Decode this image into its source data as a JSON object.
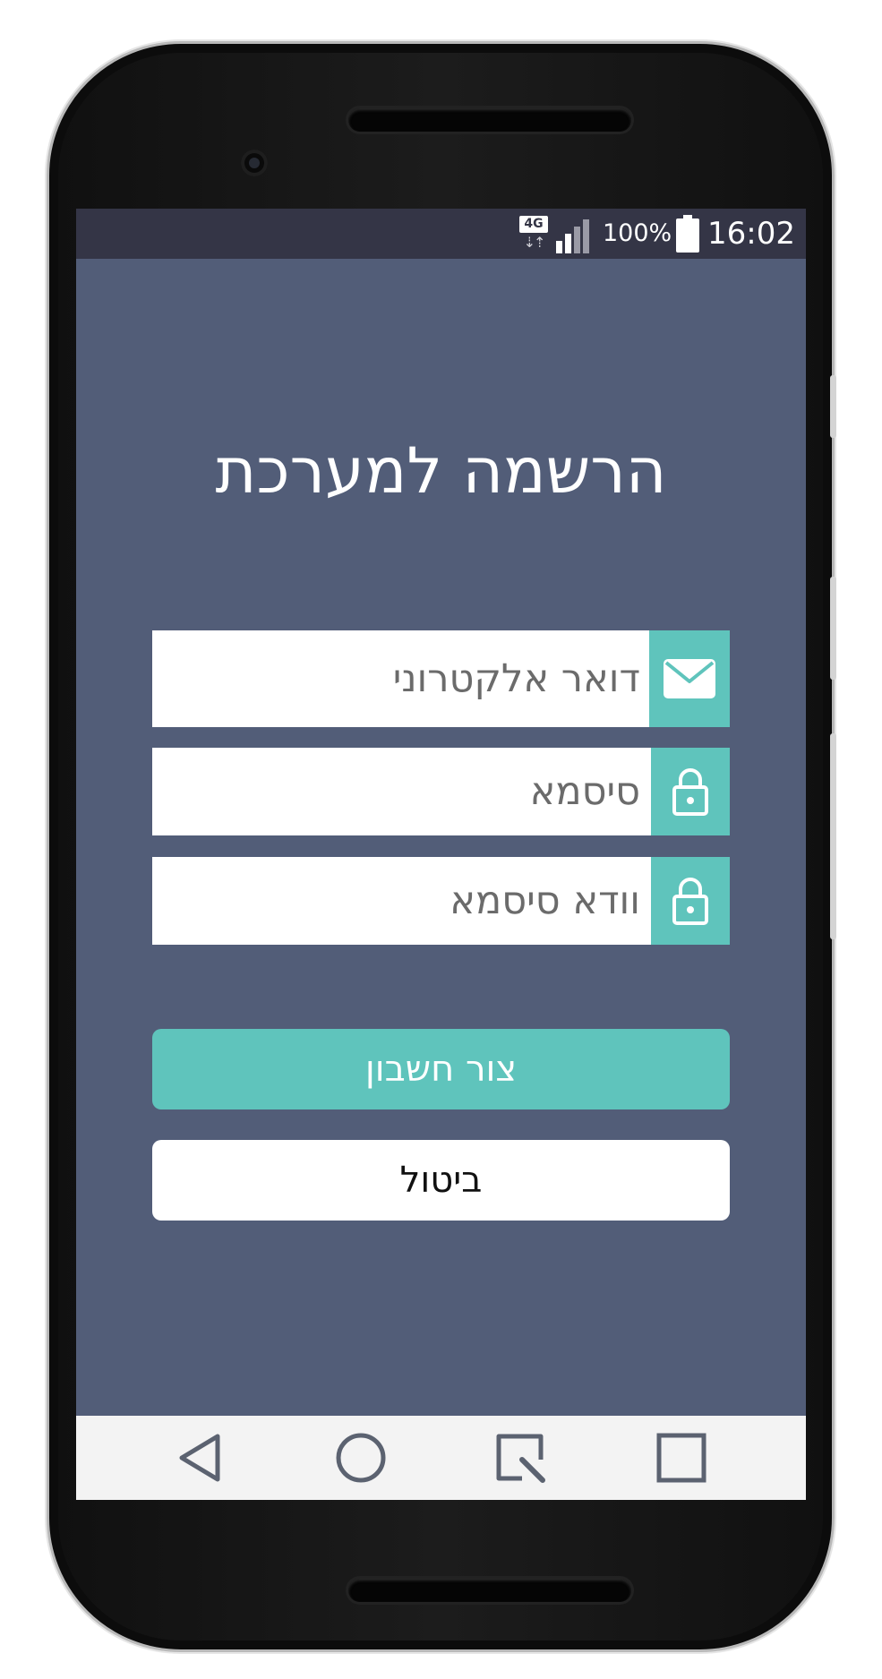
{
  "status_bar": {
    "network_type": "4G",
    "network_arrows": "⇣⇡",
    "battery_percent": "100%",
    "time": "16:02"
  },
  "screen": {
    "title": "הרשמה למערכת",
    "background_color": "#525d78",
    "accent_color": "#5fc4bc"
  },
  "form": {
    "email_placeholder": "דואר אלקטרוני",
    "email_icon": "envelope-icon",
    "password_placeholder": "סיסמא",
    "password_icon": "lock-icon",
    "confirm_password_placeholder": "וודא סיסמא",
    "confirm_password_icon": "lock-icon"
  },
  "buttons": {
    "create_account": "צור חשבון",
    "cancel": "ביטול"
  },
  "nav_bar": {
    "icons": [
      "back-icon",
      "home-icon",
      "recents-icon",
      "overview-icon"
    ]
  }
}
